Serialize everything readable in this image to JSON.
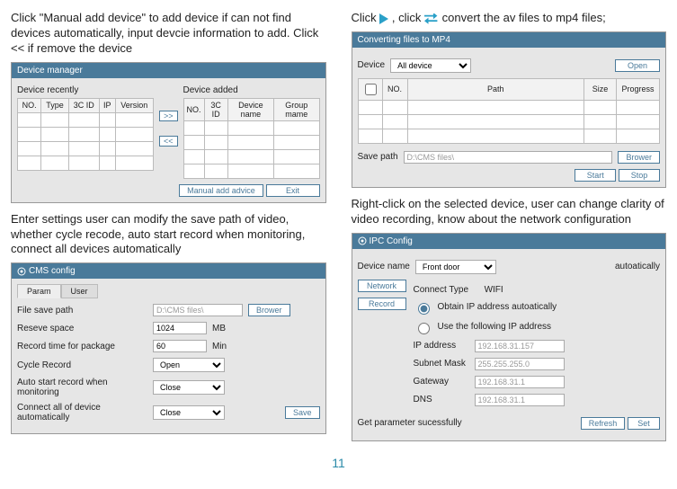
{
  "left_top_instr": "Click \"Manual add device\" to add device if can not find devices automatically, input devcie information to add. Click << if remove the device",
  "right_top_instr_pre": "Click ",
  "right_top_instr_mid": " , click ",
  "right_top_instr_post": " convert the av files to mp4 files;",
  "left_bottom_instr": "Enter settings user can modify the save path of video, whether cycle recode, auto start record when monitoring, connect all devices automatically",
  "right_bottom_instr": "Right-click on the selected device, user can change clarity of video recording, know about the network configuration",
  "dm": {
    "title": "Device manager",
    "recently": "Device recently",
    "added": "Device added",
    "recent_cols": [
      "NO.",
      "Type",
      "3C ID",
      "IP",
      "Version"
    ],
    "added_cols": [
      "NO.",
      "3C ID",
      "Device name",
      "Group mame"
    ],
    "move_right": ">>",
    "move_left": "<<",
    "manual": "Manual add advice",
    "exit": "Exit"
  },
  "conv": {
    "title": "Converting files to MP4",
    "device": "Device",
    "all": "All device",
    "open": "Open",
    "cols": [
      "NO.",
      "Path",
      "Size",
      "Progress"
    ],
    "save_path": "Save path",
    "path_val": "D:\\CMS files\\",
    "brower": "Brower",
    "start": "Start",
    "stop": "Stop"
  },
  "cms": {
    "title": "CMS config",
    "tab_param": "Param",
    "tab_user": "User",
    "file_save_path": "File save path",
    "path_val": "D:\\CMS files\\",
    "brower": "Brower",
    "reseve": "Reseve space",
    "reseve_val": "1024",
    "mb": "MB",
    "rec_time": "Record  time for package",
    "rec_time_val": "60",
    "min": "Min",
    "cycle": "Cycle Record",
    "cycle_val": "Open",
    "auto_start": "Auto start record when monitoring",
    "auto_start_val": "Close",
    "connect_all": "Connect all of device automatically",
    "connect_all_val": "Close",
    "save": "Save"
  },
  "ipc": {
    "title": "IPC Config",
    "device_name": "Device name",
    "device_sel": "Front door",
    "auto": "autoatically",
    "network": "Network",
    "record": "Record",
    "connect_type": "Connect Type",
    "wifi": "WIFI",
    "obtain": "Obtain IP address autoatically",
    "use_following": "Use the following IP address",
    "ip_lbl": "IP address",
    "ip_val": "192.168.31.157",
    "subnet_lbl": "Subnet Mask",
    "subnet_val": "255.255.255.0",
    "gw_lbl": "Gateway",
    "gw_val": "192.168.31.1",
    "dns_lbl": "DNS",
    "dns_val": "192.168.31.1",
    "status": "Get parameter sucessfully",
    "refresh": "Refresh",
    "set": "Set"
  },
  "page_number": "11"
}
